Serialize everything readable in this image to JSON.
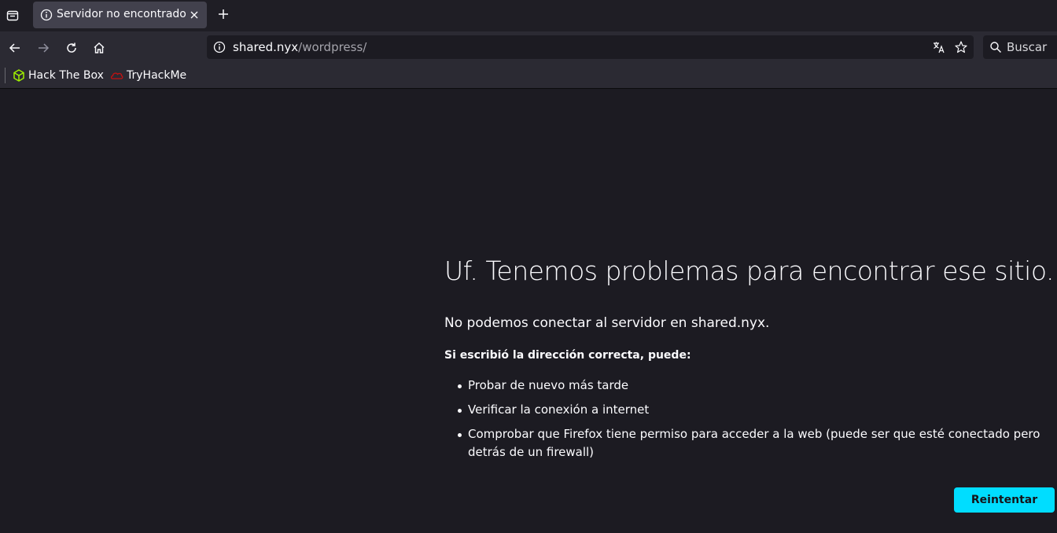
{
  "tab": {
    "title": "Servidor no encontrado"
  },
  "urlbar": {
    "host": "shared.nyx",
    "path": "/wordpress/"
  },
  "search": {
    "placeholder": "Buscar"
  },
  "bookmarks": [
    {
      "label": "Hack The Box",
      "icon": "hackthebox-icon",
      "color": "#9fef00"
    },
    {
      "label": "TryHackMe",
      "icon": "tryhackme-icon",
      "color": "#c11111"
    }
  ],
  "error": {
    "title": "Uf. Tenemos problemas para encontrar ese sitio.",
    "description": "No podemos conectar al servidor en shared.nyx.",
    "subtitle": "Si escribió la dirección correcta, puede:",
    "suggestions": [
      "Probar de nuevo más tarde",
      "Verificar la conexión a internet",
      "Comprobar que Firefox tiene permiso para acceder a la web (puede ser que esté conectado pero detrás de un firewall)"
    ],
    "retry_label": "Reintentar"
  },
  "colors": {
    "accent": "#00ddff",
    "page_bg": "#1c1b22",
    "toolbar_bg": "#2b2a33"
  }
}
